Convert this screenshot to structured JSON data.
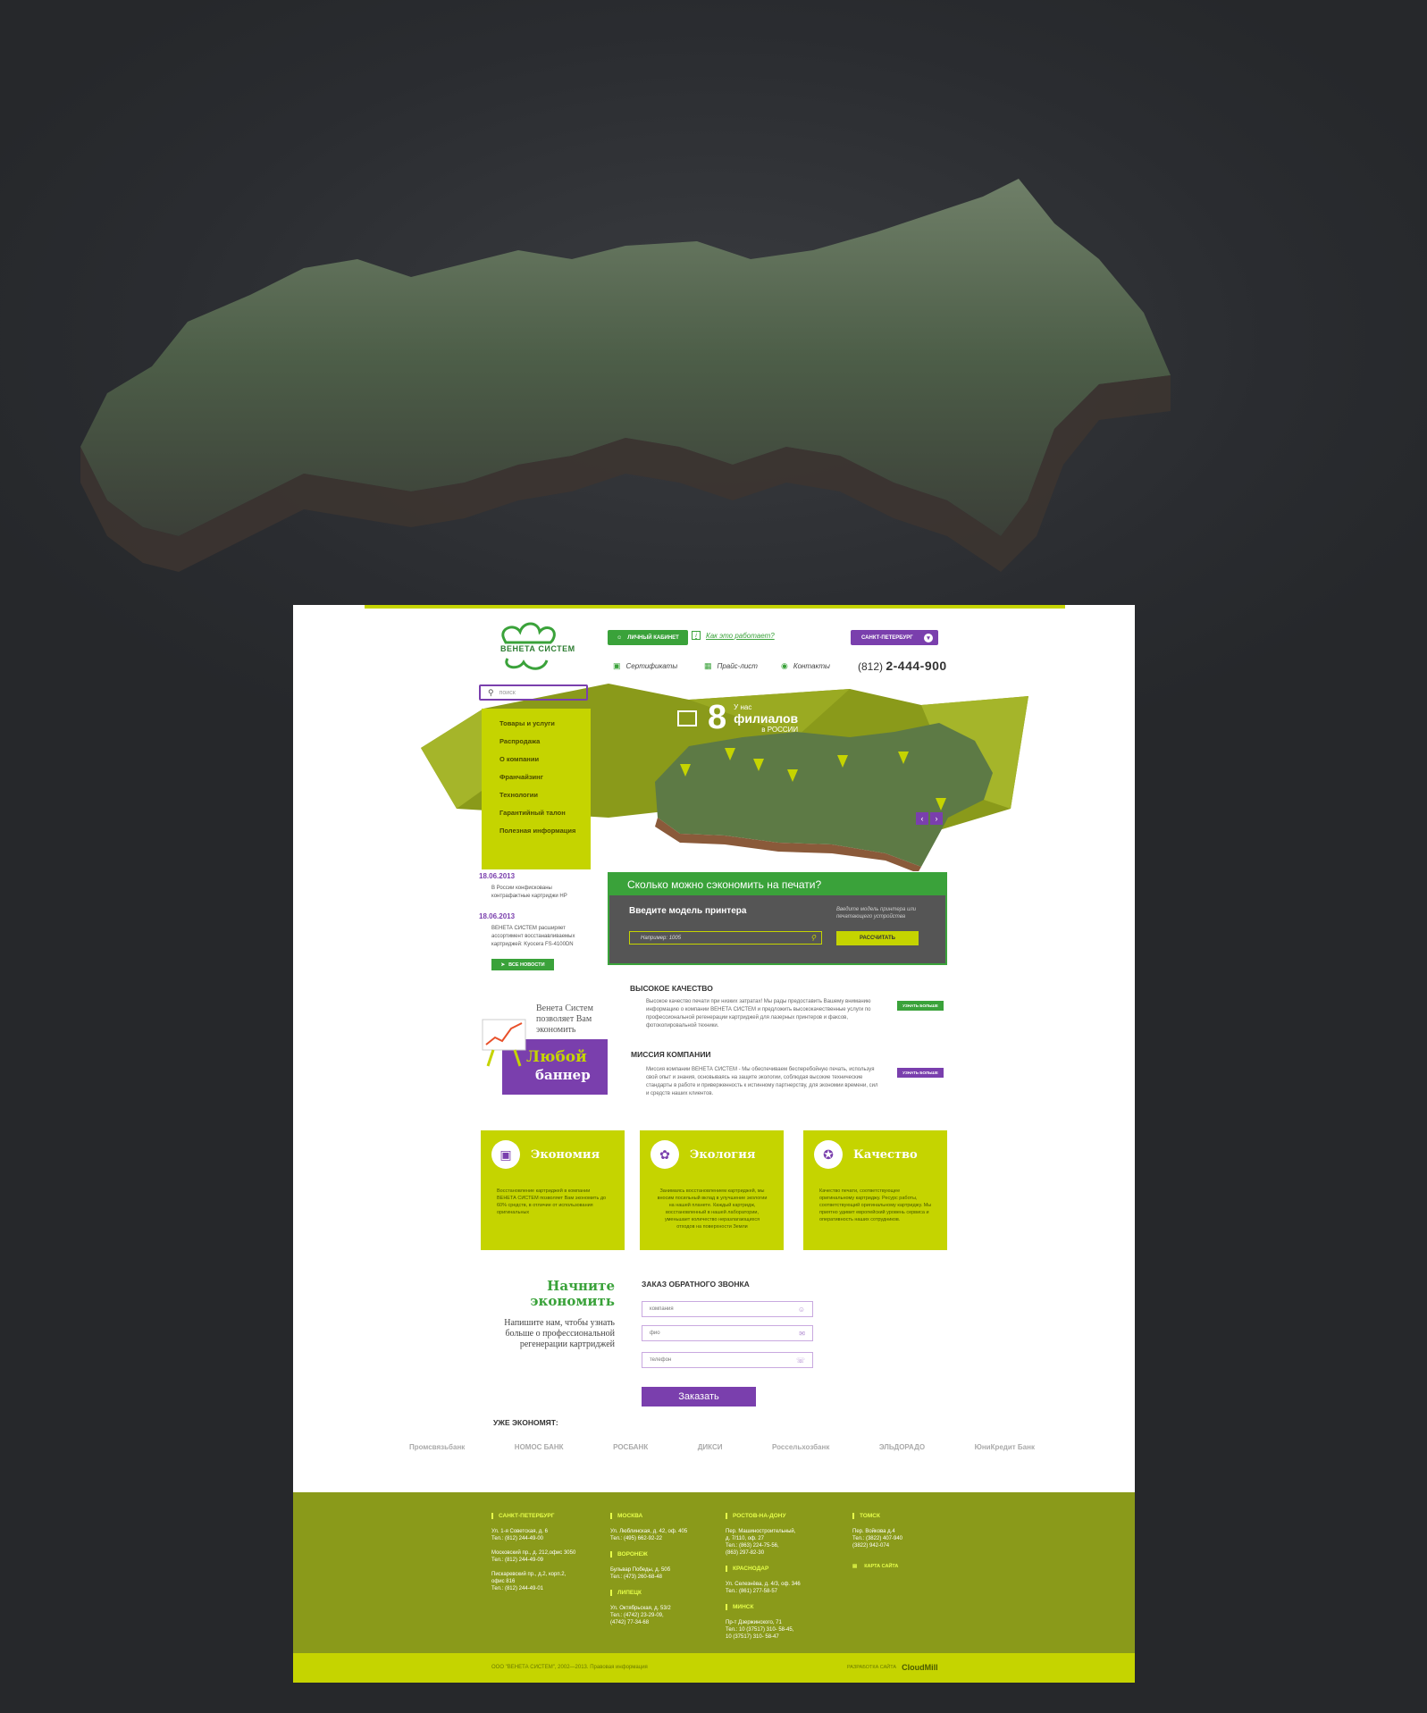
{
  "header": {
    "logo_text": "ВЕНЕТА СИСТЕМ",
    "cabinet_label": "ЛИЧНЫЙ КАБИНЕТ",
    "how_label": "Как это работает?",
    "city_label": "САНКТ-ПЕТЕРБУРГ",
    "nav": [
      "Сертификаты",
      "Прайс-лист",
      "Контакты"
    ],
    "phone_code": "(812)",
    "phone_number": "2-444-900",
    "search_placeholder": "поиск"
  },
  "menu": [
    "Товары и услуги",
    "Распродажа",
    "О компании",
    "Франчайзинг",
    "Технологии",
    "Гарантийный талон",
    "Полезная информация"
  ],
  "banner": {
    "count": "8",
    "line1": "У нас",
    "line2": "филиалов",
    "line3": "в РОССИИ"
  },
  "news": [
    {
      "date": "18.06.2013",
      "text": "В России конфискованы контрафактные картриджи HP"
    },
    {
      "date": "18.06.2013",
      "text": "ВЕНЕТА СИСТЕМ расширяет ассортимент восстанавливаемых картриджей: Kyocera FS-4100DN"
    }
  ],
  "all_news_label": "ВСЕ НОВОСТИ",
  "calc": {
    "header": "Сколько можно сэкономить на печати?",
    "title": "Введите модель принтера",
    "hint": "Введите модель принтера или печатающего устройства",
    "input_placeholder": "Например: 1005",
    "button": "РАССЧИТАТЬ"
  },
  "quality": {
    "title": "ВЫСОКОЕ КАЧЕСТВО",
    "text": "Высокое качество печати при низких затратах! Мы рады предоставить Вашему вниманию информацию о компании ВЕНЕТА СИСТЕМ и предложить высококачественные услуги по профессиональной регенерации картриджей для лазерных принтеров и факсов, фотокопировальной техники.",
    "button": "УЗНАТЬ БОЛЬШЕ"
  },
  "mission": {
    "title": "МИССИЯ КОМПАНИИ",
    "text": "Миссия компании ВЕНЕТА СИСТЕМ - Мы обеспечиваем бесперебойную печать, используя свой опыт и знания, основываясь на защите экологии, соблюдая высокие технические стандарты в работе и приверженность к истинному партнерству, для экономии времени, сил и средств наших клиентов.",
    "button": "УЗНАТЬ БОЛЬШЕ"
  },
  "promo": {
    "text": "Венета Систем позволяет Вам экономить",
    "big": "Любой",
    "small": "баннер"
  },
  "cards": [
    {
      "title": "Экономия",
      "text": "Восстановление картриджей в компании ВЕНЕТА СИСТЕМ позволяет Вам экономить до 60% средств, в отличие от использования оригинальных"
    },
    {
      "title": "Экология",
      "text": "Занимаясь восстановлением картриджей, мы вносим посильный вклад в улучшение экологии на нашей планете. Каждый картридж, восстановленный в нашей лаборатории, уменьшает количество неразлагающихся отходов на поверхности Земли"
    },
    {
      "title": "Качество",
      "text": "Качество печати, соответствующее оригинальному картриджу. Ресурс работы, соответствующий оригинальному картриджу. Мы приятно удивит европейский уровень сервиса и оперативность наших сотрудников."
    }
  ],
  "callback": {
    "left_title": "Начните экономить",
    "left_text": "Напишите нам, чтобы узнать больше о профессиональной регенерации картриджей",
    "title": "ЗАКАЗ ОБРАТНОГО ЗВОНКА",
    "fields": [
      "компания",
      "фио",
      "телефон"
    ],
    "button": "Заказать"
  },
  "clients_title": "УЖЕ ЭКОНОМЯТ:",
  "clients": [
    "Промсвязьбанк",
    "НОМОС БАНК",
    "РОСБАНК",
    "ДИКСИ",
    "Россельхозбанк",
    "ЭЛЬДОРАДО",
    "ЮниКредит Банк"
  ],
  "footer": {
    "col1": [
      {
        "city": "САНКТ-ПЕТЕРБУРГ",
        "addr": [
          "Ул. 1-я Советская, д. 6",
          "Тел.: (812) 244-49-00",
          "",
          "Московский пр., д. 212,офис 3050",
          "Тел.: (812) 244-49-09",
          "",
          "Пискаревский пр., д.2, корп.2,",
          "офис 816",
          "Тел.: (812) 244-49-01"
        ]
      }
    ],
    "col2": [
      {
        "city": "МОСКВА",
        "addr": [
          "Ул. Люблинская, д. 42, оф. 405",
          "Тел.: (495) 662-92-22"
        ]
      },
      {
        "city": "ВОРОНЕЖ",
        "addr": [
          "Бульвар Победы, д. 50б",
          "Тел.: (473) 260-68-48"
        ]
      },
      {
        "city": "ЛИПЕЦК",
        "addr": [
          "Ул. Октябрьская, д. 53/2",
          "Тел.: (4742) 23-29-09,",
          "(4742) 77-34-68"
        ]
      }
    ],
    "col3": [
      {
        "city": "РОСТОВ-НА-ДОНУ",
        "addr": [
          "Пер. Машиностроительный,",
          "д. 7/110, оф. 27",
          "Тел.: (863) 224-75-56,",
          "(863) 297-82-30"
        ]
      },
      {
        "city": "КРАСНОДАР",
        "addr": [
          "Ул. Селезнёва, д. 4/3, оф. 346",
          "Тел.: (861) 277-58-57"
        ]
      },
      {
        "city": "МИНСК",
        "addr": [
          "Пр-т Дзержинского, 71",
          "Тел.: 10 (37517) 310- 58-45,",
          "10 (37517) 310- 58-47"
        ]
      }
    ],
    "col4": [
      {
        "city": "ТОМСК",
        "addr": [
          "Пер. Войкова д.4",
          "Тел.: (3822) 407-940",
          "(3822) 942-074"
        ]
      }
    ],
    "site_map": "КАРТА САЙТА",
    "copyright": "ООО \"ВЕНЕТА СИСТЕМ\", 2002—2013. Правовая информация",
    "dev_label": "РАЗРАБОТКА САЙТА",
    "dev_name": "CloudMill"
  },
  "colors": {
    "lime": "#c5d400",
    "green": "#3aa23a",
    "purple": "#7a3fad",
    "olive": "#8a9a1a",
    "bg": "#2d2f33"
  }
}
